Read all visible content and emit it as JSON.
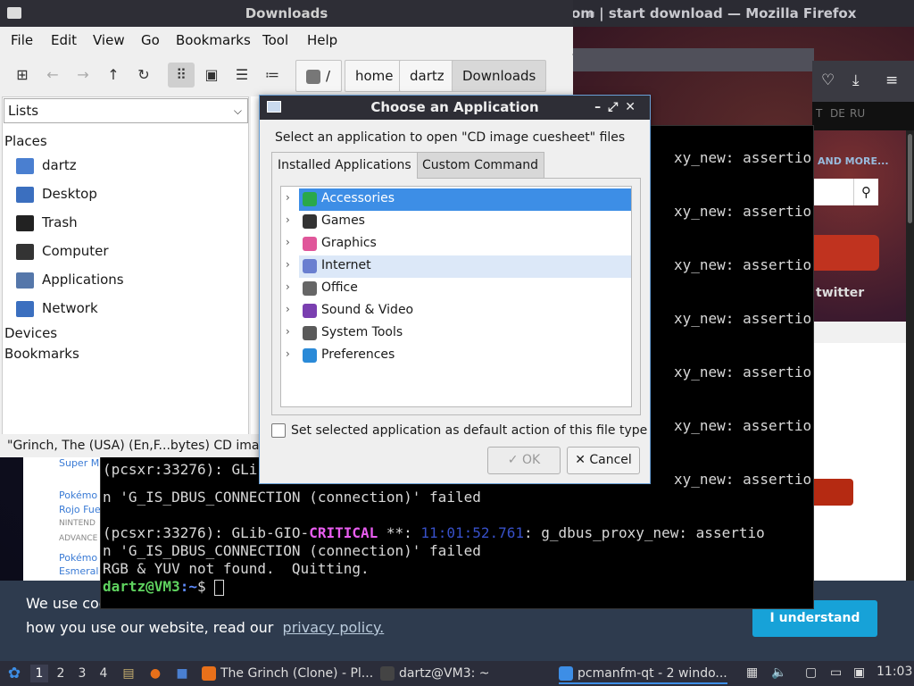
{
  "firefox": {
    "title": "om | start download — Mozilla Firefox",
    "lang": [
      "T",
      "DE",
      "RU"
    ],
    "more_label": "AND MORE...",
    "search_icon": "search-icon",
    "twitter": "twitter",
    "side_items": [
      {
        "label": "Super M",
        "color": "#3a7bd5"
      },
      {
        "label": "Pokémo",
        "color": "#3a7bd5"
      },
      {
        "label": "Rojo Fue",
        "color": "#3a7bd5"
      },
      {
        "label": "NINTEND",
        "color": "#888888"
      },
      {
        "label": "ADVANCE",
        "color": "#888888"
      },
      {
        "label": "Pokémo",
        "color": "#3a7bd5"
      },
      {
        "label": "Esmeral",
        "color": "#3a7bd5"
      }
    ],
    "cookie": {
      "line1": "We use coo",
      "line2": "how you use our website, read our",
      "link": "privacy policy.",
      "button": "I understand"
    }
  },
  "terminal": {
    "lines": [
      {
        "pre": "",
        "crit": "",
        "time": "",
        "post": "xy_new: assertio"
      },
      {
        "pre": "",
        "crit": "",
        "time": "",
        "post": "xy_new: assertio"
      },
      {
        "pre": "",
        "crit": "",
        "time": "",
        "post": "xy_new: assertio"
      },
      {
        "pre": "",
        "crit": "",
        "time": "",
        "post": "xy_new: assertio"
      },
      {
        "pre": "",
        "crit": "",
        "time": "",
        "post": "xy_new: assertio"
      },
      {
        "pre": "",
        "crit": "",
        "time": "",
        "post": "xy_new: assertio"
      },
      {
        "pre": "(pcsxr:33276): GLi",
        "crit": "",
        "time": "",
        "post": ""
      },
      {
        "pre": "",
        "crit": "",
        "time": "",
        "post": "xy_new: assertio"
      }
    ],
    "failed_line": "n 'G_IS_DBUS_CONNECTION (connection)' failed",
    "crit_line": {
      "pre": "(pcsxr:33276): GLib-GIO-",
      "crit": "CRITICAL",
      "mid": " **: ",
      "time": "11:01:52.761",
      "post": ": g_dbus_proxy_new: assertio"
    },
    "failed_line2": "n 'G_IS_DBUS_CONNECTION (connection)' failed",
    "quit_line": "RGB & YUV not found.  Quitting.",
    "prompt_user": "dartz@VM3",
    "prompt_path": ":~",
    "prompt_end": "$ "
  },
  "filemanager": {
    "title": "Downloads",
    "menu": [
      "File",
      "Edit",
      "View",
      "Go",
      "Bookmarks",
      "Tool",
      "Help"
    ],
    "toolbar_icons": [
      "new-tab-icon",
      "back-arrow-icon",
      "forward-arrow-icon",
      "up-arrow-icon",
      "reload-icon",
      "icon-view-icon",
      "thumbnail-view-icon",
      "compact-view-icon",
      "detailed-list-icon"
    ],
    "path_root": "/",
    "path": [
      "home",
      "dartz",
      "Downloads"
    ],
    "side_combo": "Lists",
    "places_label": "Places",
    "places": [
      {
        "label": "dartz",
        "icon": "home-folder-icon",
        "color": "#4a7fd0"
      },
      {
        "label": "Desktop",
        "icon": "desktop-icon",
        "color": "#3b6fbf"
      },
      {
        "label": "Trash",
        "icon": "trash-icon",
        "color": "#222222"
      },
      {
        "label": "Computer",
        "icon": "computer-icon",
        "color": "#333333"
      },
      {
        "label": "Applications",
        "icon": "applications-icon",
        "color": "#5577aa"
      },
      {
        "label": "Network",
        "icon": "network-icon",
        "color": "#3b6fbf"
      }
    ],
    "devices_label": "Devices",
    "bookmarks_label": "Bookmarks",
    "status": "\"Grinch, The (USA) (En,F...bytes) CD image"
  },
  "dialog": {
    "title": "Choose an Application",
    "message": "Select an application to open \"CD image cuesheet\" files",
    "tabs": [
      "Installed Applications",
      "Custom Command"
    ],
    "categories": [
      {
        "label": "Accessories",
        "icon": "accessories-icon",
        "color": "#2aa84a",
        "state": "selected"
      },
      {
        "label": "Games",
        "icon": "games-icon",
        "color": "#333333",
        "state": ""
      },
      {
        "label": "Graphics",
        "icon": "graphics-icon",
        "color": "#e0569a",
        "state": ""
      },
      {
        "label": "Internet",
        "icon": "internet-icon",
        "color": "#6a7fd0",
        "state": "hover"
      },
      {
        "label": "Office",
        "icon": "office-icon",
        "color": "#666666",
        "state": ""
      },
      {
        "label": "Sound & Video",
        "icon": "sound-video-icon",
        "color": "#7a3fb0",
        "state": ""
      },
      {
        "label": "System Tools",
        "icon": "system-tools-icon",
        "color": "#5a5a5a",
        "state": ""
      },
      {
        "label": "Preferences",
        "icon": "preferences-icon",
        "color": "#2a8ad8",
        "state": ""
      }
    ],
    "checkbox_label": "Set selected application as default action of this file type",
    "ok": "OK",
    "cancel": "Cancel"
  },
  "taskbar": {
    "workspaces": [
      "1",
      "2",
      "3",
      "4"
    ],
    "tasks": [
      {
        "label": "The Grinch (Clone) - Pl...",
        "icon": "firefox-icon",
        "color": "#e8701a"
      },
      {
        "label": "dartz@VM3: ~",
        "icon": "terminal-icon",
        "color": "#444444"
      },
      {
        "label": "pcmanfm-qt - 2 windo...",
        "icon": "file-manager-icon",
        "color": "#3d8ee6"
      }
    ],
    "clock": "11:03"
  }
}
